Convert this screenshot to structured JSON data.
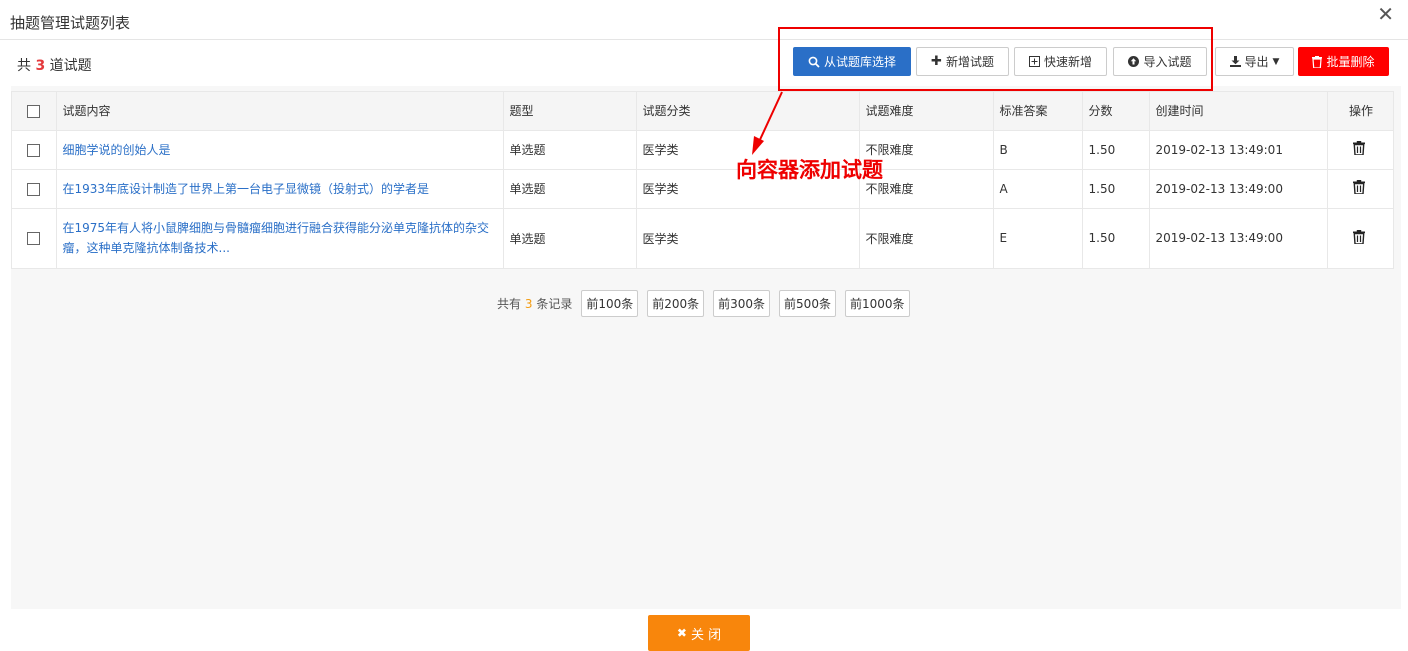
{
  "dialog": {
    "title": "抽题管理试题列表",
    "close_symbol": "✕"
  },
  "toolbar": {
    "count_prefix": "共",
    "count": "3",
    "count_suffix": "道试题",
    "select_from_bank": "从试题库选择",
    "add_question": "新增试题",
    "quick_add": "快速新增",
    "import": "导入试题",
    "export": "导出",
    "batch_delete": "批量删除"
  },
  "annotation": {
    "text": "向容器添加试题"
  },
  "table": {
    "headers": {
      "content": "试题内容",
      "type": "题型",
      "category": "试题分类",
      "difficulty": "试题难度",
      "answer": "标准答案",
      "score": "分数",
      "created": "创建时间",
      "actions": "操作"
    },
    "rows": [
      {
        "content": "细胞学说的创始人是",
        "type": "单选题",
        "category": "医学类",
        "difficulty": "不限难度",
        "answer": "B",
        "score": "1.50",
        "created": "2019-02-13 13:49:01"
      },
      {
        "content": "在1933年底设计制造了世界上第一台电子显微镜（投射式）的学者是",
        "type": "单选题",
        "category": "医学类",
        "difficulty": "不限难度",
        "answer": "A",
        "score": "1.50",
        "created": "2019-02-13 13:49:00"
      },
      {
        "content": "在1975年有人将小鼠脾细胞与骨髓瘤细胞进行融合获得能分泌单克隆抗体的杂交瘤，这种单克隆抗体制备技术...",
        "type": "单选题",
        "category": "医学类",
        "difficulty": "不限难度",
        "answer": "E",
        "score": "1.50",
        "created": "2019-02-13 13:49:00"
      }
    ]
  },
  "pager": {
    "prefix": "共有",
    "count": "3",
    "suffix": "条记录",
    "buttons": [
      "前100条",
      "前200条",
      "前300条",
      "前500条",
      "前1000条"
    ]
  },
  "footer": {
    "close_label": "关 闭"
  },
  "colors": {
    "primary": "#2a6fc7",
    "danger": "#ff0000",
    "accent": "#f8860c",
    "annotation": "#ee0000"
  }
}
